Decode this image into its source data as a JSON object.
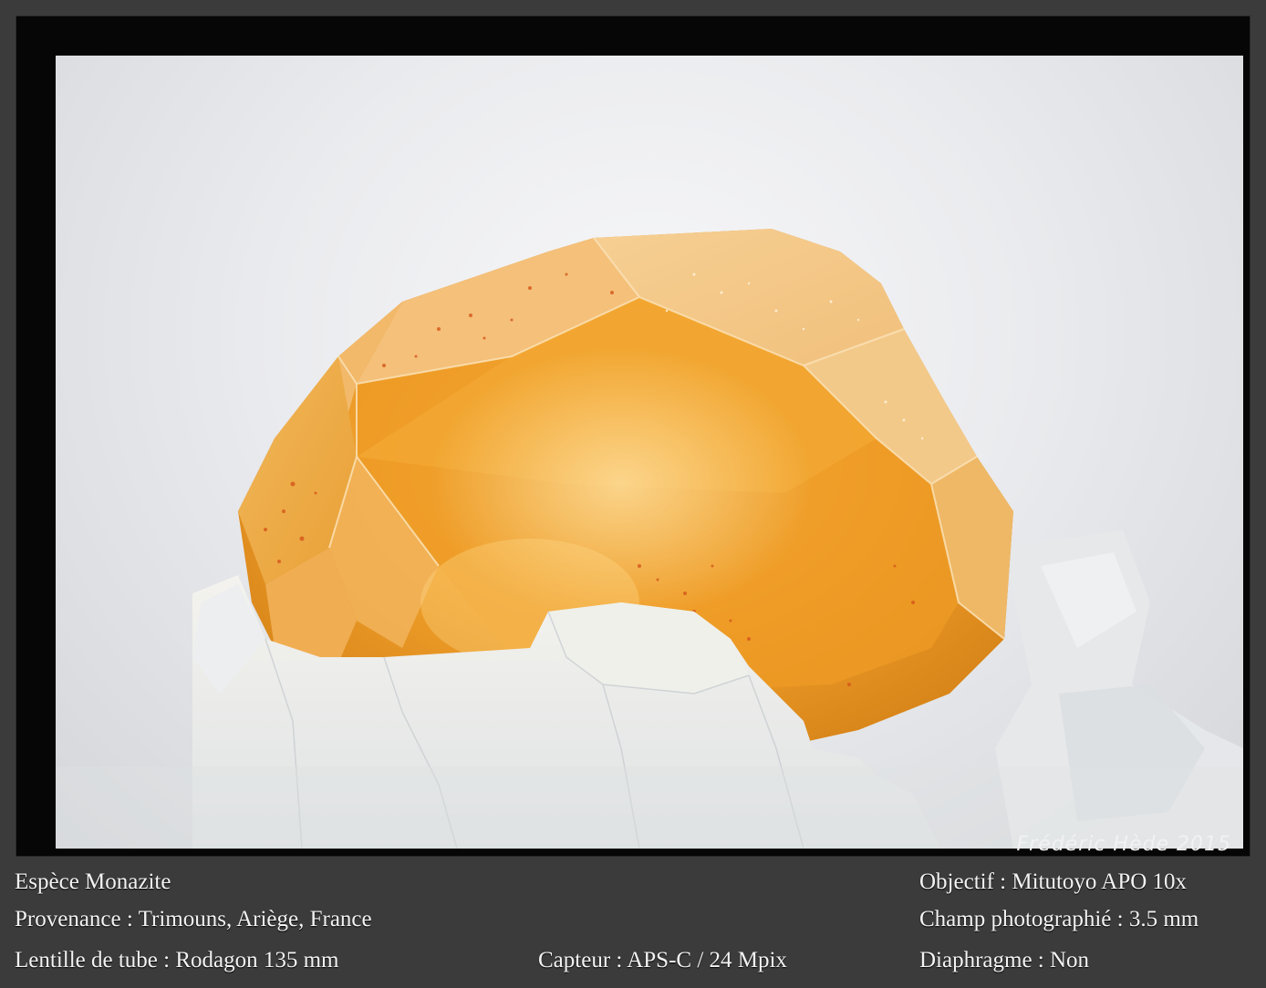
{
  "photo": {
    "subject": "monazite-crystal-photo",
    "signature": "Frédéric Hède 2015"
  },
  "captions": {
    "espece": "Espèce Monazite",
    "provenance": "Provenance : Trimouns, Ariège, France",
    "lentille": "Lentille de tube : Rodagon 135 mm",
    "capteur": "Capteur : APS-C / 24 Mpix",
    "objectif": "Objectif : Mitutoyo APO 10x",
    "champ": "Champ photographié : 3.5 mm",
    "diaphragme": "Diaphragme : Non"
  },
  "colors": {
    "background": "#3b3b3b",
    "frame": "#060606",
    "crystal": "#f0a22c",
    "text": "#f3f3f3"
  }
}
